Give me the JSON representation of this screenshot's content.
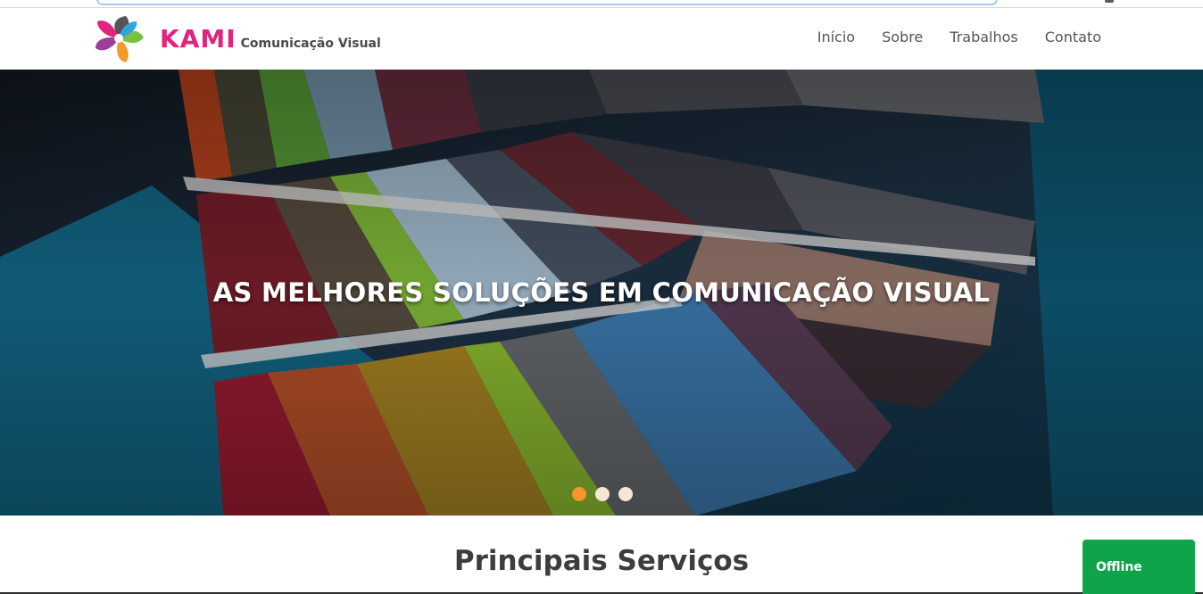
{
  "brand": {
    "name": "KAMI",
    "tagline": "Comunicação Visual",
    "logo_icon": "pinwheel-logo-icon"
  },
  "nav": {
    "items": [
      {
        "label": "Início"
      },
      {
        "label": "Sobre"
      },
      {
        "label": "Trabalhos"
      },
      {
        "label": "Contato"
      }
    ]
  },
  "hero": {
    "title": "AS MELHORES SOLUÇÕES EM COMUNICAÇÃO VISUAL",
    "slides_count": 3,
    "active_slide": 1,
    "image_subject": "color swatch fan"
  },
  "section": {
    "title": "Principais Serviços"
  },
  "chat": {
    "status": "Offline"
  },
  "colors": {
    "brand_pink": "#e0247f",
    "dot_active": "#f3962b",
    "dot_inactive": "#f5e6d6",
    "chat_green": "#0fa34a"
  }
}
